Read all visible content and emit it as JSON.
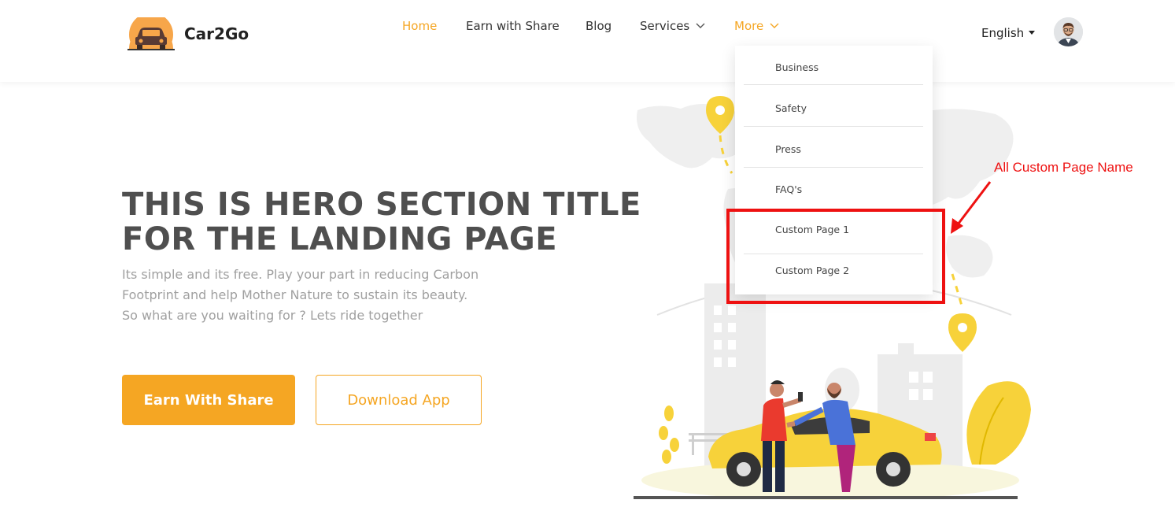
{
  "brand": {
    "name": "Car2Go",
    "accent": "#f5a623"
  },
  "nav": {
    "items": [
      {
        "label": "Home",
        "active": true
      },
      {
        "label": "Earn with Share"
      },
      {
        "label": "Blog"
      },
      {
        "label": "Services",
        "dropdown": true
      },
      {
        "label": "More",
        "dropdown": true,
        "open": true
      }
    ]
  },
  "language": {
    "selected": "English"
  },
  "dropdown": {
    "items": [
      "Business",
      "Safety",
      "Press",
      "FAQ's",
      "Custom Page 1",
      "Custom Page 2"
    ]
  },
  "hero": {
    "title_line1": "THIS IS HERO SECTION TITLE",
    "title_line2": "FOR THE LANDING PAGE",
    "subtitle_line1": "Its simple and its free. Play your part in reducing Carbon",
    "subtitle_line2": "Footprint and help Mother Nature to sustain its beauty.",
    "subtitle_line3": "So what are you waiting for ? Lets ride together",
    "primary_button": "Earn With Share",
    "secondary_button": "Download App"
  },
  "annotation": {
    "text": "All Custom Page Name",
    "color": "#ee1111"
  }
}
